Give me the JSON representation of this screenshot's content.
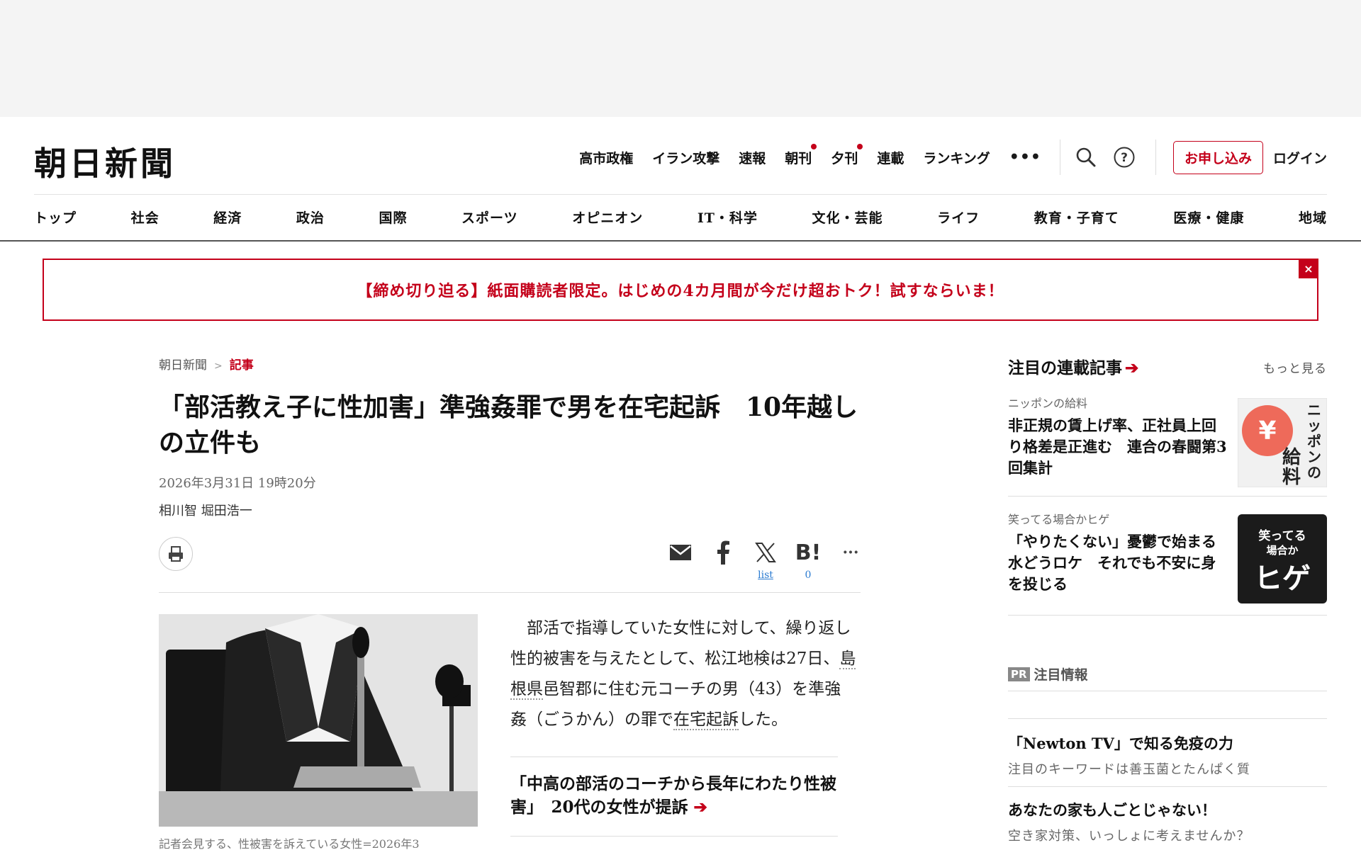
{
  "header": {
    "logo": "朝日新聞",
    "topnav": [
      {
        "label": "高市政権",
        "dot": false
      },
      {
        "label": "イラン攻撃",
        "dot": false
      },
      {
        "label": "速報",
        "dot": false
      },
      {
        "label": "朝刊",
        "dot": true
      },
      {
        "label": "夕刊",
        "dot": true
      },
      {
        "label": "連載",
        "dot": false
      },
      {
        "label": "ランキング",
        "dot": false
      }
    ],
    "more_label": "•••",
    "apply_label": "お申し込み",
    "login_label": "ログイン",
    "categories": [
      "トップ",
      "社会",
      "経済",
      "政治",
      "国際",
      "スポーツ",
      "オピニオン",
      "IT・科学",
      "文化・芸能",
      "ライフ",
      "教育・子育て",
      "医療・健康",
      "地域"
    ]
  },
  "promo": {
    "text": "【締め切り迫る】紙面購読者限定。はじめの4カ月間が今だけ超おトク！試すならいま！",
    "close": "×"
  },
  "article": {
    "breadcrumb": [
      "朝日新聞",
      "記事"
    ],
    "breadcrumb_sep": ">",
    "headline": "「部活教え子に性加害」準強姦罪で男を在宅起訴　10年越しの立件も",
    "date": "2026年3月31日 19時20分",
    "authors": "相川智 堀田浩一",
    "share": {
      "x_count": "list",
      "hatena_count": "0",
      "more": "···"
    },
    "caption": "記者会見する、性被害を訴えている女性=2026年3",
    "body": {
      "p1": "　部活で指導していた女性に対して、繰り返し性的被害を与えたとして、松江地検は27日、",
      "link1": "島根県",
      "p2": "邑智郡に住む元コーチの男（43）を準強姦（ごうかん）の罪で",
      "link2": "在宅起訴",
      "p3": "した。"
    },
    "related": {
      "text": "「中高の部活のコーチから長年にわたり性被害」　20代の女性が提訴",
      "arrow": "➔"
    }
  },
  "sidebar": {
    "title": "注目の連載記事",
    "arrow": "➔",
    "more": "もっと見る",
    "items": [
      {
        "label": "ニッポンの給料",
        "title": "非正規の賃上げ率、正社員上回り格差是正進む　連合の春闘第3回集計",
        "thumb_text": "ニッポンの給料"
      },
      {
        "label": "笑ってる場合かヒゲ",
        "title": "「やりたくない」憂鬱で始まる水どうロケ　それでも不安に身を投じる",
        "thumb_text": "笑ってる場合かヒゲ"
      }
    ],
    "pr_badge": "PR",
    "pr_title": "注目情報",
    "pr_items": [
      {
        "title": "「Newton TV」で知る免疫の力",
        "sub": "注目のキーワードは善玉菌とたんぱく質"
      },
      {
        "title": "あなたの家も人ごとじゃない！",
        "sub": "空き家対策、いっしょに考えませんか？"
      }
    ]
  },
  "colors": {
    "accent": "#c4001a",
    "link": "#2b7bd1"
  }
}
